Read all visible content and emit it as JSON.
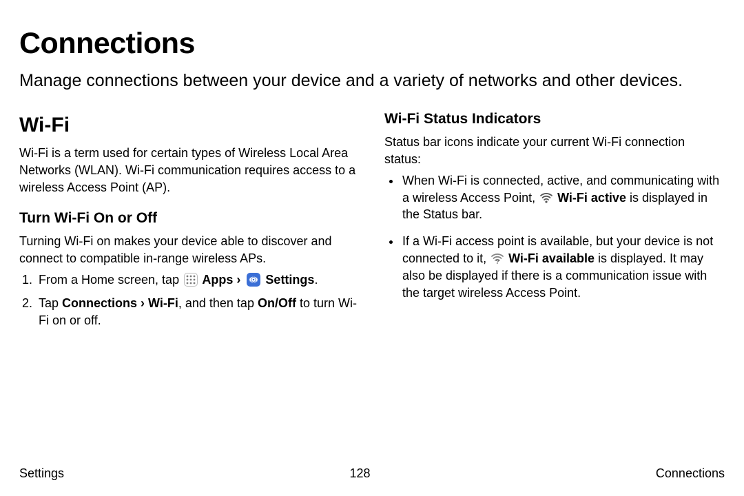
{
  "page": {
    "title": "Connections",
    "intro": "Manage connections between your device and a variety of networks and other devices."
  },
  "left": {
    "h2": "Wi-Fi",
    "intro": "Wi-Fi is a term used for certain types of Wireless Local Area Networks (WLAN). Wi-Fi communication requires access to a wireless Access Point (AP).",
    "turn": {
      "heading": "Turn Wi-Fi On or Off",
      "intro": "Turning Wi-Fi on makes your device able to discover and connect to compatible in-range wireless APs.",
      "step1_pre": "From a Home screen, tap ",
      "step1_apps": " Apps",
      "step1_sep": " › ",
      "step1_settings": " Settings",
      "step1_post": ".",
      "step2_pre": "Tap ",
      "step2_path": "Connections › Wi-Fi",
      "step2_mid": ", and then tap ",
      "step2_onoff": "On/Off",
      "step2_post": " to turn Wi-Fi on or off."
    }
  },
  "right": {
    "heading": "Wi-Fi Status Indicators",
    "intro": "Status bar icons indicate your current Wi-Fi connection status:",
    "b1_pre": "When Wi-Fi is connected, active, and communicating with a wireless Access Point, ",
    "b1_label": " Wi-Fi active",
    "b1_post": " is displayed in the Status bar.",
    "b2_pre": "If a Wi-Fi access point is available, but your device is not connected to it, ",
    "b2_label": " Wi-Fi available",
    "b2_post": " is displayed. It may also be displayed if there is a communication issue with the target wireless Access Point."
  },
  "footer": {
    "left": "Settings",
    "center": "128",
    "right": "Connections"
  }
}
